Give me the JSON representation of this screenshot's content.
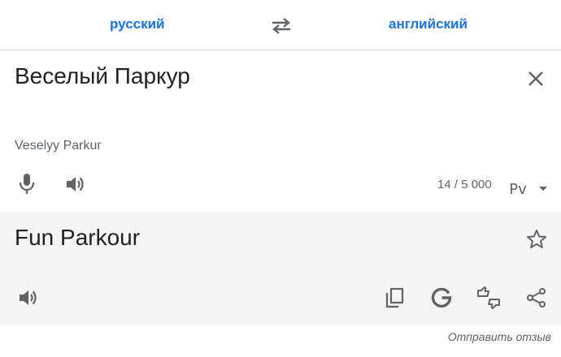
{
  "languages": {
    "source": "русский",
    "target": "английский",
    "swap_icon": "swap-arrows-icon"
  },
  "input": {
    "text": "Веселый Паркур",
    "transliteration": "Veselyy Parkur",
    "char_count": "14 / 5 000",
    "keyboard_label": "Pv",
    "icons": [
      "close-icon",
      "microphone-icon",
      "speaker-icon",
      "keyboard-dropdown-icon"
    ]
  },
  "output": {
    "text": "Fun Parkour",
    "icons": [
      "star-icon",
      "speaker-icon",
      "copy-icon",
      "google-icon",
      "thumbs-feedback-icon",
      "share-icon"
    ]
  },
  "footer": {
    "feedback_label": "Отправить отзыв"
  },
  "colors": {
    "accent": "#1a73e8",
    "icon": "#5f6368",
    "output_bg": "#f5f5f5",
    "divider": "#dadce0"
  }
}
